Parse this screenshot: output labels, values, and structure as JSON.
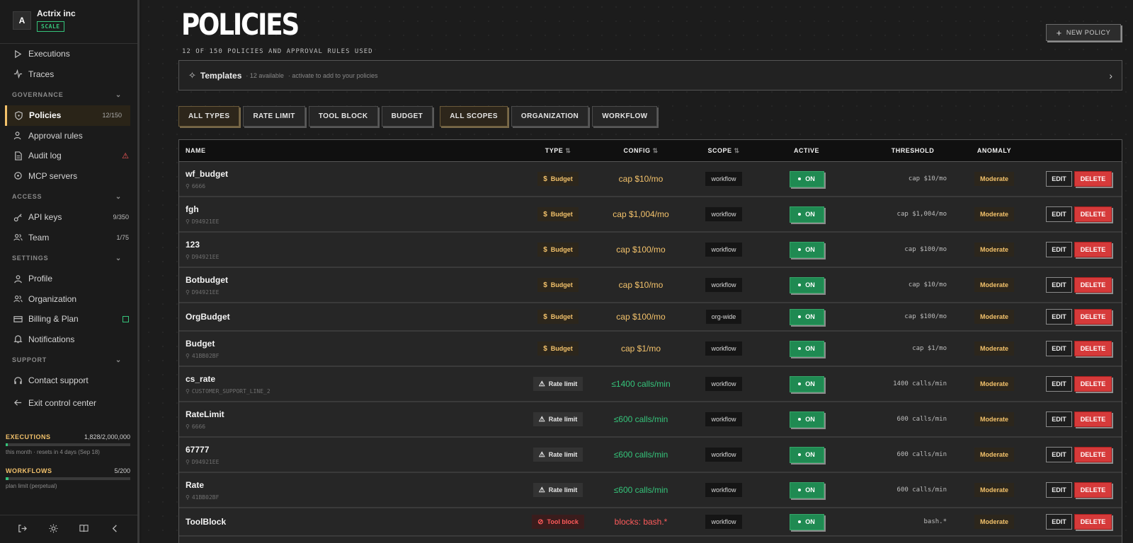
{
  "org": {
    "avatar": "A",
    "name": "Actrix inc",
    "plan": "SCALE"
  },
  "nav": {
    "executions": "Executions",
    "traces": "Traces",
    "governance_header": "GOVERNANCE",
    "policies": "Policies",
    "policies_count": "12/150",
    "approval_rules": "Approval rules",
    "audit_log": "Audit log",
    "mcp_servers": "MCP servers",
    "access_header": "ACCESS",
    "api_keys": "API keys",
    "api_keys_count": "9/350",
    "team": "Team",
    "team_count": "1/75",
    "settings_header": "SETTINGS",
    "profile": "Profile",
    "organization": "Organization",
    "billing": "Billing & Plan",
    "notifications": "Notifications",
    "support_header": "SUPPORT",
    "contact_support": "Contact support",
    "exit": "Exit control center"
  },
  "usage": {
    "executions_label": "EXECUTIONS",
    "executions_value": "1,828/2,000,000",
    "executions_fraction": 0.0009,
    "executions_note": "this month · resets in 4 days (Sep 18)",
    "workflows_label": "WORKFLOWS",
    "workflows_value": "5/200",
    "workflows_fraction": 0.025,
    "workflows_note": "plan limit (perpetual)"
  },
  "page": {
    "title": "POLICIES",
    "subtitle": "12 OF 150 POLICIES AND APPROVAL RULES USED",
    "new_button": "NEW POLICY"
  },
  "templates": {
    "title": "Templates",
    "available": "· 12 available",
    "hint": "· activate to add to your policies"
  },
  "filters": {
    "types": [
      "ALL TYPES",
      "RATE LIMIT",
      "TOOL BLOCK",
      "BUDGET"
    ],
    "scopes": [
      "ALL SCOPES",
      "ORGANIZATION",
      "WORKFLOW"
    ]
  },
  "table": {
    "headers": {
      "name": "NAME",
      "type": "TYPE",
      "config": "CONFIG",
      "scope": "SCOPE",
      "active": "ACTIVE",
      "threshold": "THRESHOLD",
      "anomaly": "ANOMALY"
    },
    "edit_label": "EDIT",
    "delete_label": "DELETE",
    "on_label": "ON",
    "rows": [
      {
        "name": "wf_budget",
        "id": "6666",
        "type": "Budget",
        "kind": "budget",
        "config": "cap $10/mo",
        "scope": "workflow",
        "threshold": "cap $10/mo",
        "anomaly": "Moderate"
      },
      {
        "name": "fgh",
        "id": "D94921EE",
        "type": "Budget",
        "kind": "budget",
        "config": "cap $1,004/mo",
        "scope": "workflow",
        "threshold": "cap $1,004/mo",
        "anomaly": "Moderate"
      },
      {
        "name": "123",
        "id": "D94921EE",
        "type": "Budget",
        "kind": "budget",
        "config": "cap $100/mo",
        "scope": "workflow",
        "threshold": "cap $100/mo",
        "anomaly": "Moderate"
      },
      {
        "name": "Botbudget",
        "id": "D94921EE",
        "type": "Budget",
        "kind": "budget",
        "config": "cap $10/mo",
        "scope": "workflow",
        "threshold": "cap $10/mo",
        "anomaly": "Moderate"
      },
      {
        "name": "OrgBudget",
        "id": "",
        "type": "Budget",
        "kind": "budget",
        "config": "cap $100/mo",
        "scope": "org-wide",
        "threshold": "cap $100/mo",
        "anomaly": "Moderate"
      },
      {
        "name": "Budget",
        "id": "41BB02BF",
        "type": "Budget",
        "kind": "budget",
        "config": "cap $1/mo",
        "scope": "workflow",
        "threshold": "cap $1/mo",
        "anomaly": "Moderate"
      },
      {
        "name": "cs_rate",
        "id": "CUSTOMER_SUPPORT_LINE_2",
        "type": "Rate limit",
        "kind": "rate",
        "config": "≤1400 calls/min",
        "scope": "workflow",
        "threshold": "1400 calls/min",
        "anomaly": "Moderate"
      },
      {
        "name": "RateLimit",
        "id": "6666",
        "type": "Rate limit",
        "kind": "rate",
        "config": "≤600 calls/min",
        "scope": "workflow",
        "threshold": "600 calls/min",
        "anomaly": "Moderate"
      },
      {
        "name": "67777",
        "id": "D94921EE",
        "type": "Rate limit",
        "kind": "rate",
        "config": "≤600 calls/min",
        "scope": "workflow",
        "threshold": "600 calls/min",
        "anomaly": "Moderate"
      },
      {
        "name": "Rate",
        "id": "41BB02BF",
        "type": "Rate limit",
        "kind": "rate",
        "config": "≤600 calls/min",
        "scope": "workflow",
        "threshold": "600 calls/min",
        "anomaly": "Moderate"
      },
      {
        "name": "ToolBlock",
        "id": "",
        "type": "Tool block",
        "kind": "tool",
        "config": "blocks: bash.*",
        "scope": "workflow",
        "threshold": "bash.*",
        "anomaly": "Moderate"
      }
    ]
  }
}
